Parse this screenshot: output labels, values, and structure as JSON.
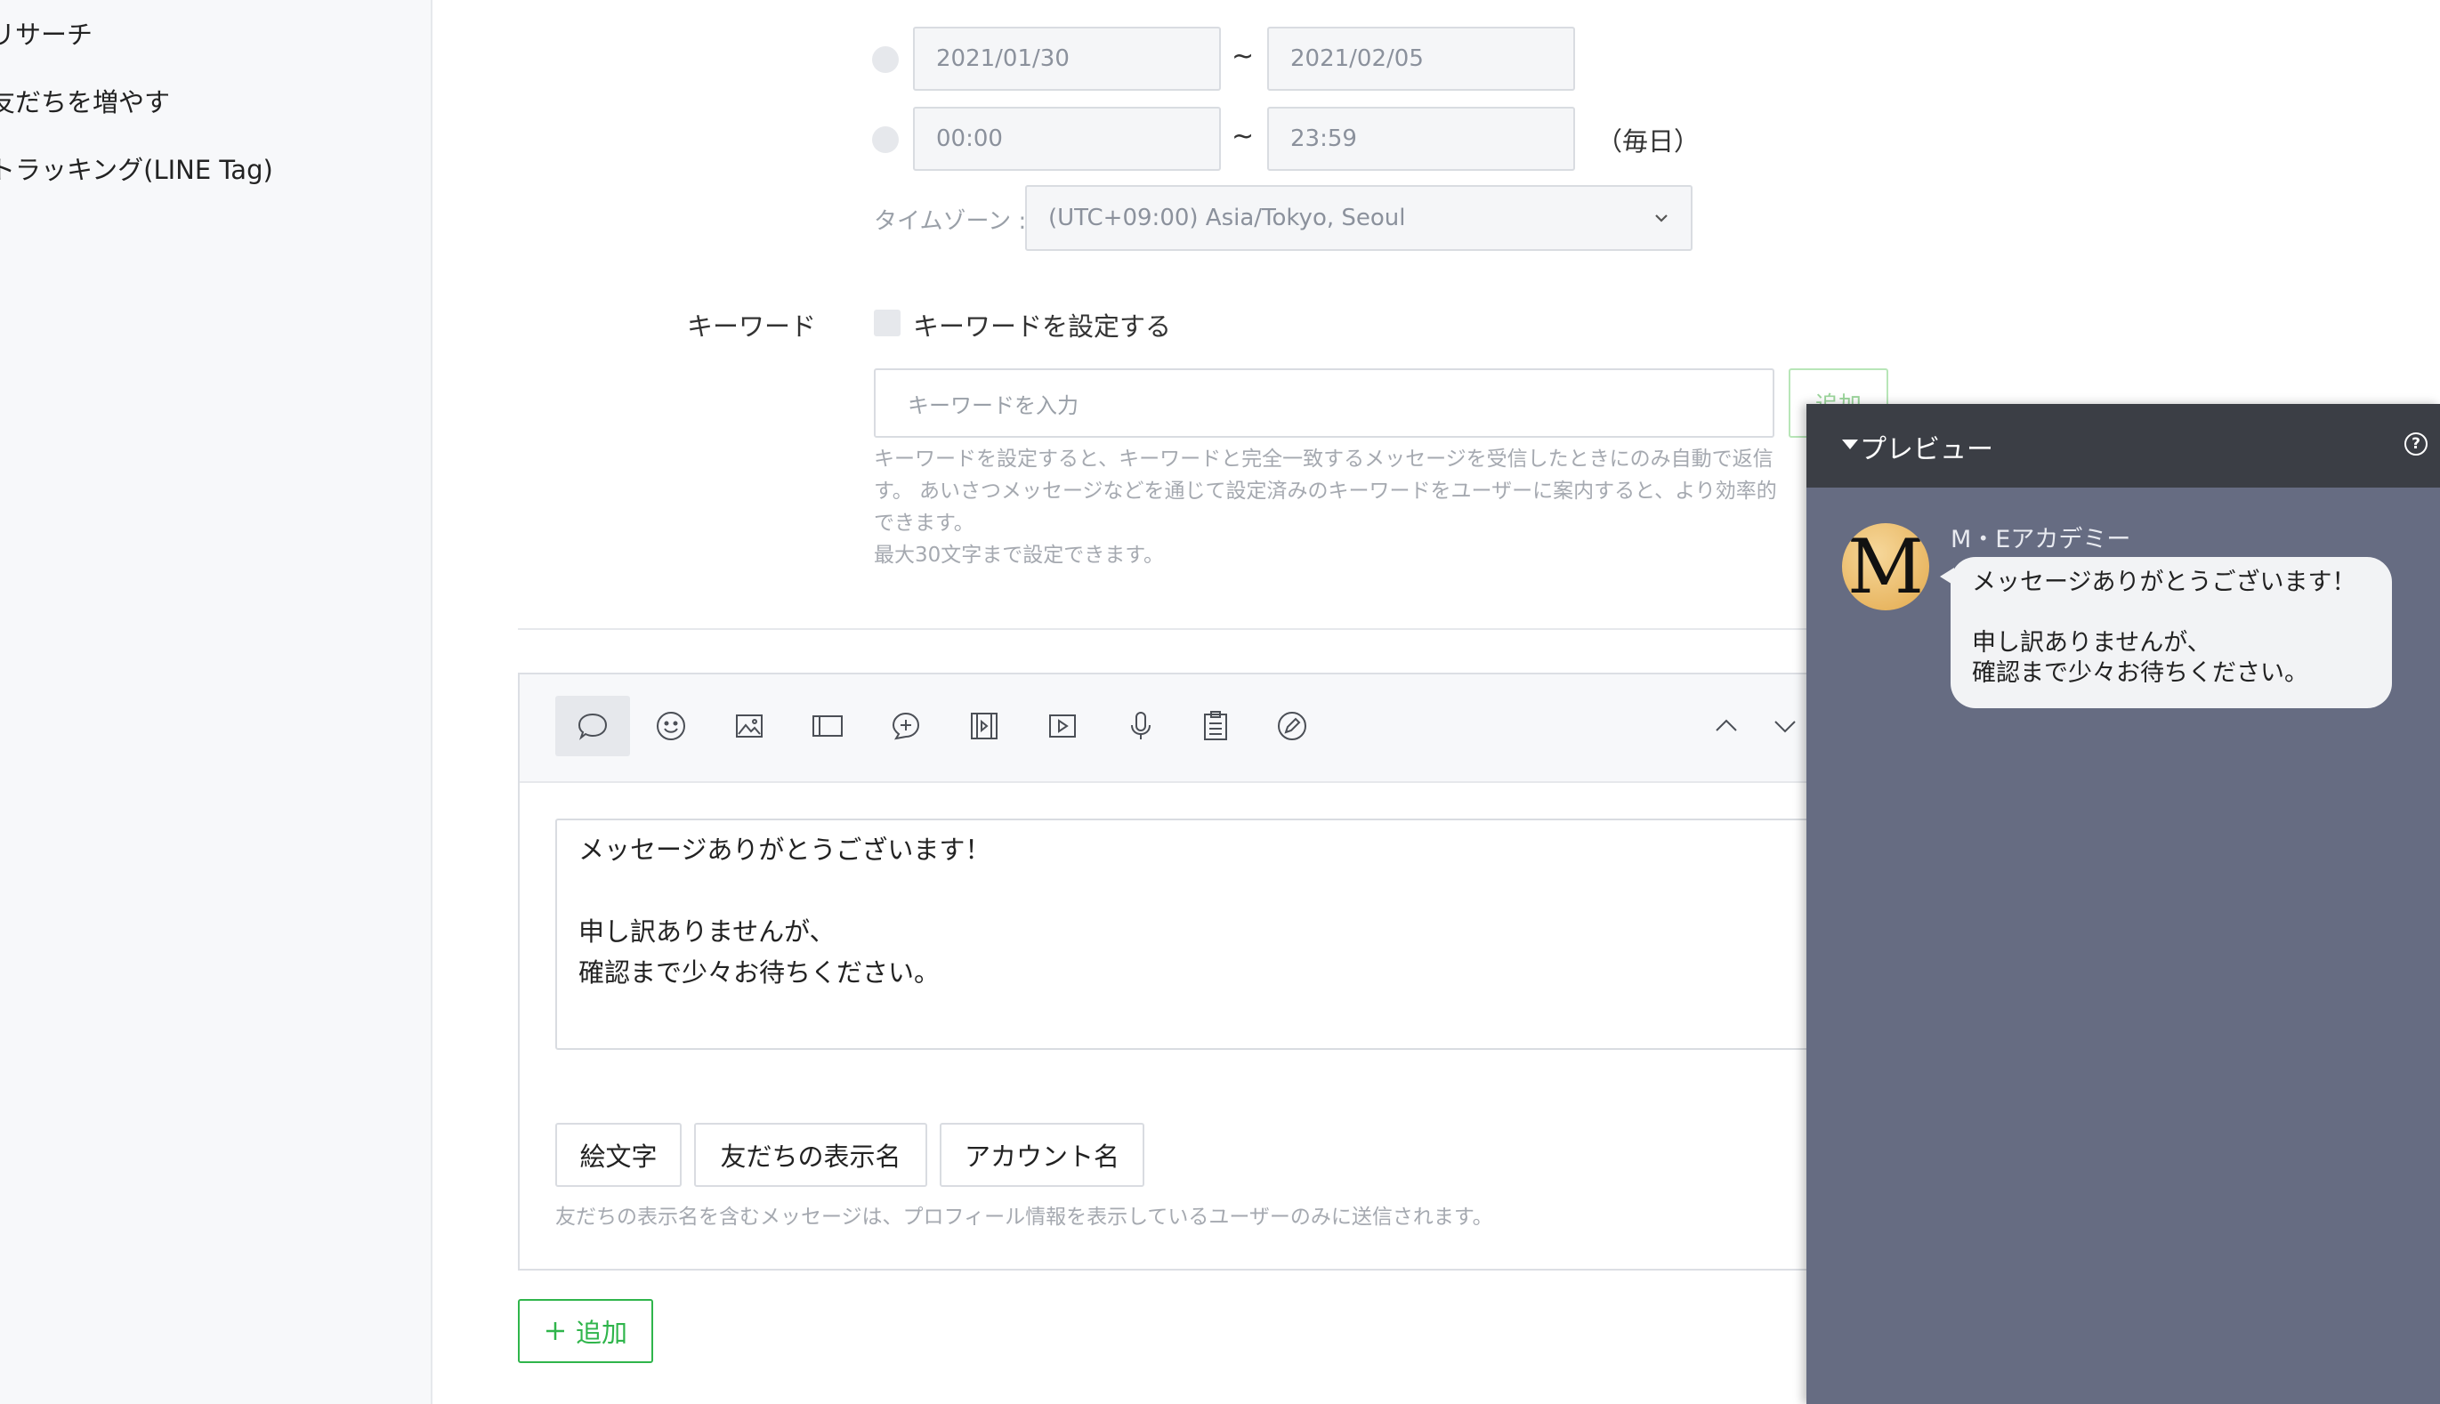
{
  "sidebar": {
    "items": [
      {
        "label": "リサーチ"
      },
      {
        "label": "友だちを増やす"
      },
      {
        "label": "トラッキング(LINE Tag)"
      }
    ]
  },
  "schedule": {
    "date_start": "2021/01/30",
    "date_end": "2021/02/05",
    "time_start": "00:00",
    "time_end": "23:59",
    "tilde": "~",
    "daily_label": "（毎日）",
    "timezone_label": "タイムゾーン :",
    "timezone_value": "(UTC+09:00) Asia/Tokyo, Seoul"
  },
  "keyword": {
    "section_label": "キーワード",
    "checkbox_label": "キーワードを設定する",
    "input_placeholder": "キーワードを入力",
    "add_label": "追加",
    "help_lines": [
      "キーワードを設定すると、キーワードと完全一致するメッセージを受信したときにのみ自動で返信",
      "す。 あいさつメッセージなどを通じて設定済みのキーワードをユーザーに案内すると、より効率的",
      "できます。",
      "最大30文字まで設定できます。"
    ]
  },
  "editor": {
    "toolbar_icons": [
      "text-bubble-icon",
      "emoji-icon",
      "image-icon",
      "card-icon",
      "response-bubble-icon",
      "video-icon",
      "play-icon",
      "mic-icon",
      "survey-icon",
      "edit-icon"
    ],
    "message_text": "メッセージありがとうございます！\n\n申し訳ありませんが、\n確認まで少々お待ちください。",
    "chips": [
      "絵文字",
      "友だちの表示名",
      "アカウント名"
    ],
    "note": "友だちの表示名を含むメッセージは、プロフィール情報を表示しているユーザーのみに送信されます。"
  },
  "add_button": {
    "label": "追加"
  },
  "preview": {
    "title": "プレビュー",
    "help": "?",
    "avatar_letter": "M",
    "sender": "M・Eアカデミー",
    "message": "メッセージありがとうございます！\n\n申し訳ありませんが、\n確認まで少々お待ちください。"
  }
}
